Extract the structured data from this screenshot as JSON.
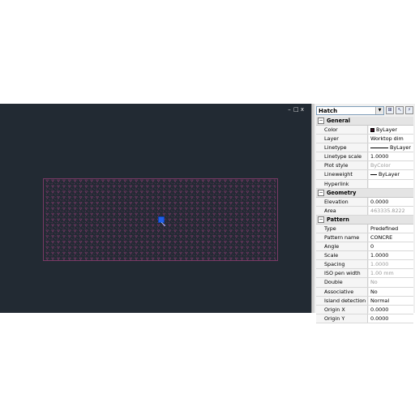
{
  "window_controls": {
    "minimize": "–",
    "restore": "□",
    "close": "x"
  },
  "palette": {
    "object_type": "Hatch",
    "sections": [
      {
        "title": "General",
        "expander": "−",
        "rows": [
          {
            "label": "Color",
            "value": "ByLayer",
            "swatch": true
          },
          {
            "label": "Layer",
            "value": "Worktop dim"
          },
          {
            "label": "Linetype",
            "value": "ByLayer",
            "line": "long"
          },
          {
            "label": "Linetype scale",
            "value": "1.0000"
          },
          {
            "label": "Plot style",
            "value": "ByColor",
            "dim": true
          },
          {
            "label": "Lineweight",
            "value": "ByLayer",
            "line": "short"
          },
          {
            "label": "Hyperlink",
            "value": ""
          }
        ]
      },
      {
        "title": "Geometry",
        "expander": "−",
        "rows": [
          {
            "label": "Elevation",
            "value": "0.0000"
          },
          {
            "label": "Area",
            "value": "463335.8222",
            "dim": true
          }
        ]
      },
      {
        "title": "Pattern",
        "expander": "−",
        "rows": [
          {
            "label": "Type",
            "value": "Predefined"
          },
          {
            "label": "Pattern name",
            "value": "CONCRE"
          },
          {
            "label": "Angle",
            "value": "0"
          },
          {
            "label": "Scale",
            "value": "1.0000"
          },
          {
            "label": "Spacing",
            "value": "1.0000",
            "dim": true
          },
          {
            "label": "ISO pen width",
            "value": "1.00 mm",
            "dim": true
          },
          {
            "label": "Double",
            "value": "No",
            "dim": true
          },
          {
            "label": "Associative",
            "value": "No"
          },
          {
            "label": "Island detection s...",
            "value": "Normal"
          },
          {
            "label": "Origin X",
            "value": "0.0000"
          },
          {
            "label": "Origin Y",
            "value": "0.0000"
          }
        ]
      }
    ]
  },
  "colors": {
    "hatch_pattern": "#8a3a70",
    "grip": "#1f5fe6",
    "canvas": "#222a33"
  }
}
